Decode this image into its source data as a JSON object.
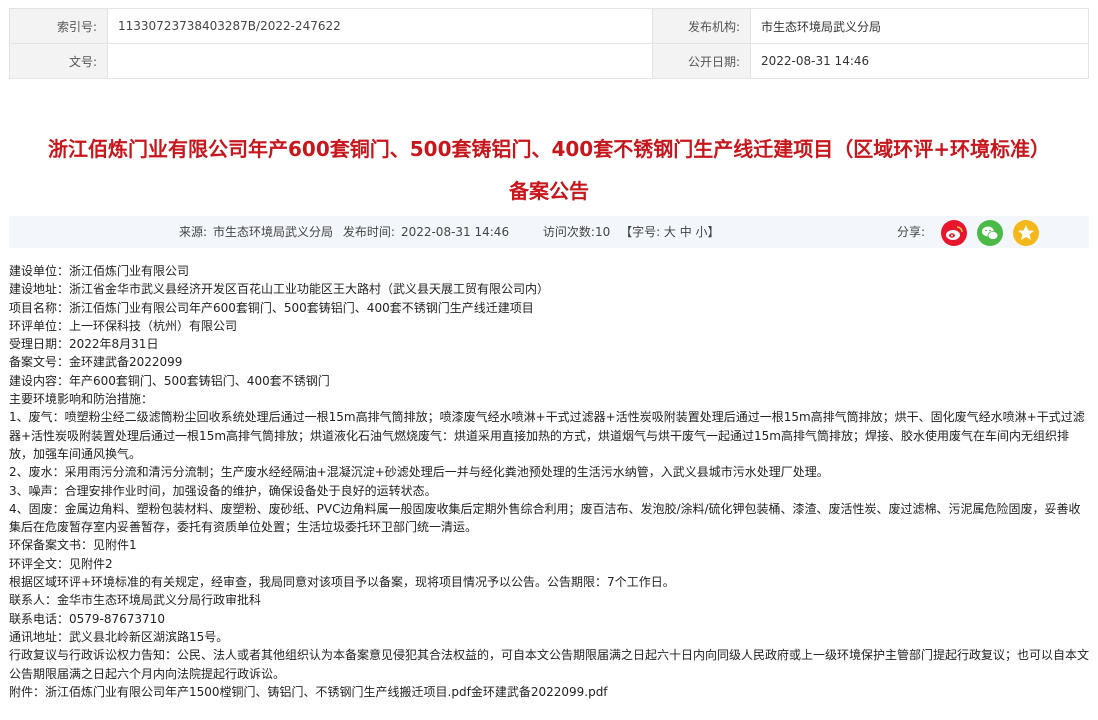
{
  "meta": {
    "index_label": "索引号:",
    "index_value": "11330723738403287B/2022-247622",
    "publisher_label": "发布机构:",
    "publisher_value": "市生态环境局武义分局",
    "doc_no_label": "文号:",
    "doc_no_value": "",
    "date_label": "公开日期:",
    "date_value": "2022-08-31 14:46"
  },
  "title": "浙江佰炼门业有限公司年产600套铜门、500套铸铝门、400套不锈钢门生产线迁建项目（区域环评+环境标准）备案公告",
  "info": {
    "source_label": "来源:",
    "source_value": "市生态环境局武义分局",
    "time_label": "发布时间:",
    "time_value": "2022-08-31 14:46",
    "visits": "访问次数:10",
    "font_size": "【字号: 大 中 小】",
    "share_label": "分享:"
  },
  "icons": {
    "weibo": "weibo-icon",
    "wechat": "wechat-icon",
    "qzone": "star-icon"
  },
  "colors": {
    "title": "#c8161d",
    "weibo": "#e6162d",
    "wechat": "#4cb846",
    "star": "#f5b81c"
  },
  "body_lines": [
    "建设单位：浙江佰炼门业有限公司",
    "建设地址：浙江省金华市武义县经济开发区百花山工业功能区王大路村（武义县天展工贸有限公司内）",
    "项目名称：浙江佰炼门业有限公司年产600套铜门、500套铸铝门、400套不锈钢门生产线迁建项目",
    "环评单位：上一环保科技（杭州）有限公司",
    "受理日期：2022年8月31日",
    "备案文号：金环建武备2022099",
    "建设内容：年产600套铜门、500套铸铝门、400套不锈钢门",
    "主要环境影响和防治措施：",
    "1、废气：喷塑粉尘经二级滤筒粉尘回收系统处理后通过一根15m高排气筒排放；喷漆废气经水喷淋+干式过滤器+活性炭吸附装置处理后通过一根15m高排气筒排放；烘干、固化废气经水喷淋+干式过滤器+活性炭吸附装置处理后通过一根15m高排气筒排放；烘道液化石油气燃烧废气：烘道采用直接加热的方式，烘道烟气与烘干废气一起通过15m高排气筒排放；焊接、胶水使用废气在车间内无组织排放，加强车间通风换气。",
    "2、废水：采用雨污分流和清污分流制；生产废水经经隔油+混凝沉淀+砂滤处理后一并与经化粪池预处理的生活污水纳管，入武义县城市污水处理厂处理。",
    "3、噪声：合理安排作业时间，加强设备的维护，确保设备处于良好的运转状态。",
    "4、固废：金属边角料、塑粉包装材料、废塑粉、废砂纸、PVC边角料属一般固废收集后定期外售综合利用；废百洁布、发泡胶/涂料/硫化钾包装桶、漆渣、废活性炭、废过滤棉、污泥属危险固废，妥善收集后在危废暂存室内妥善暂存，委托有资质单位处置；生活垃圾委托环卫部门统一清运。",
    "环保备案文书：见附件1",
    "环评全文：见附件2",
    "根据区域环评+环境标准的有关规定，经审查，我局同意对该项目予以备案，现将项目情况予以公告。公告期限：7个工作日。",
    "联系人：金华市生态环境局武义分局行政审批科",
    "联系电话：0579-87673710",
    "通讯地址：武义县北岭新区湖滨路15号。",
    "行政复议与行政诉讼权力告知：公民、法人或者其他组织认为本备案意见侵犯其合法权益的，可自本文公告期限届满之日起六十日内向同级人民政府或上一级环境保护主管部门提起行政复议；也可以自本文公告期限届满之日起六个月内向法院提起行政诉讼。",
    "附件：浙江佰炼门业有限公司年产1500樘铜门、铸铝门、不锈钢门生产线搬迁项目.pdf金环建武备2022099.pdf"
  ]
}
